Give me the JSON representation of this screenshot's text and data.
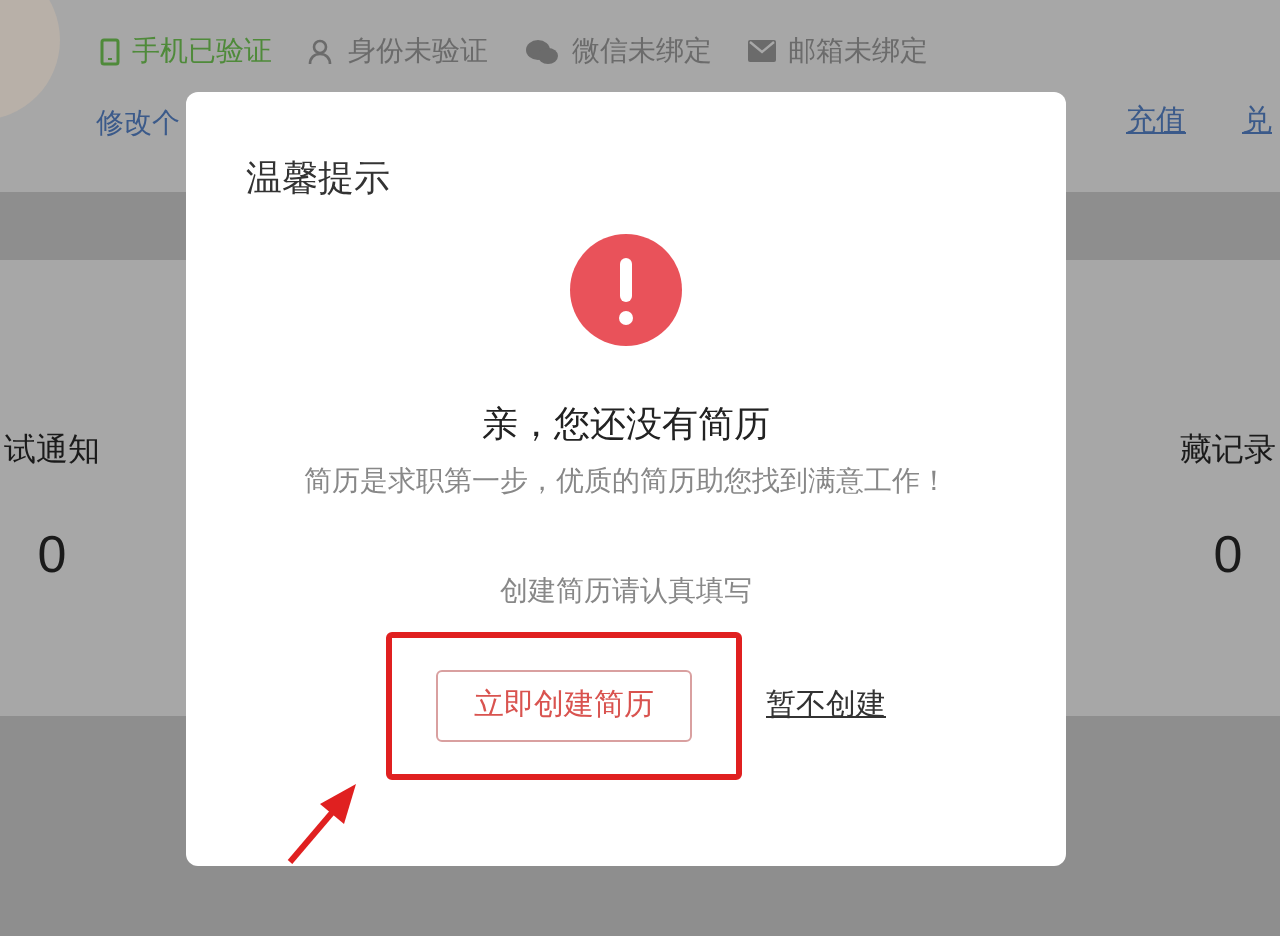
{
  "verify_items": [
    {
      "kind": "phone",
      "label": "手机已验证",
      "verified": true
    },
    {
      "kind": "id",
      "label": "身份未验证",
      "verified": false
    },
    {
      "kind": "wechat",
      "label": "微信未绑定",
      "verified": false
    },
    {
      "kind": "mail",
      "label": "邮箱未绑定",
      "verified": false
    }
  ],
  "profile_link": "修改个",
  "account_links": [
    "充值",
    "兑"
  ],
  "stats": [
    {
      "label": "试通知",
      "value": "0"
    },
    {
      "label": "藏记录",
      "value": "0"
    }
  ],
  "dialog": {
    "title": "温馨提示",
    "heading": "亲，您还没有简历",
    "subtitle": "简历是求职第一步，优质的简历助您找到满意工作！",
    "hint": "创建简历请认真填写",
    "primary_button": "立即创建简历",
    "secondary_link": "暂不创建"
  }
}
